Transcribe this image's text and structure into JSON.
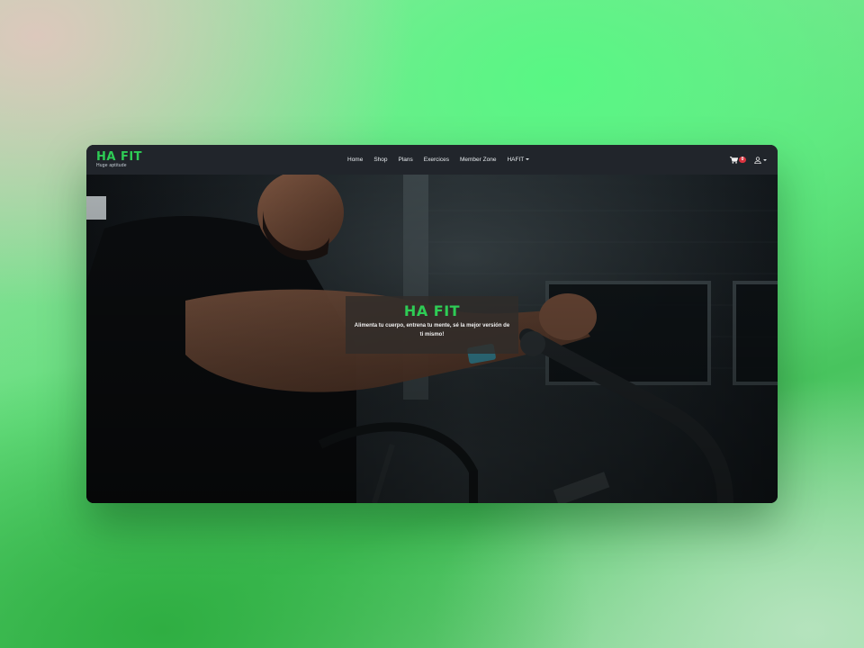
{
  "brand": {
    "name": "HA FIT",
    "tagline": "Huge aptitude"
  },
  "nav": {
    "items": [
      {
        "label": "Home"
      },
      {
        "label": "Shop"
      },
      {
        "label": "Plans"
      },
      {
        "label": "Exercices"
      },
      {
        "label": "Member Zone"
      },
      {
        "label": "HAFIT"
      }
    ]
  },
  "cart": {
    "count": "0",
    "icon": "cart-icon"
  },
  "user": {
    "icon": "user-icon"
  },
  "hero": {
    "title": "HA FIT",
    "subtitle": "Alimenta tu cuerpo, entrena tu mente, sé la mejor versión de ti mismo!"
  },
  "colors": {
    "accent": "#2ecc55",
    "navbar": "#21252b",
    "badge": "#d9333f"
  }
}
